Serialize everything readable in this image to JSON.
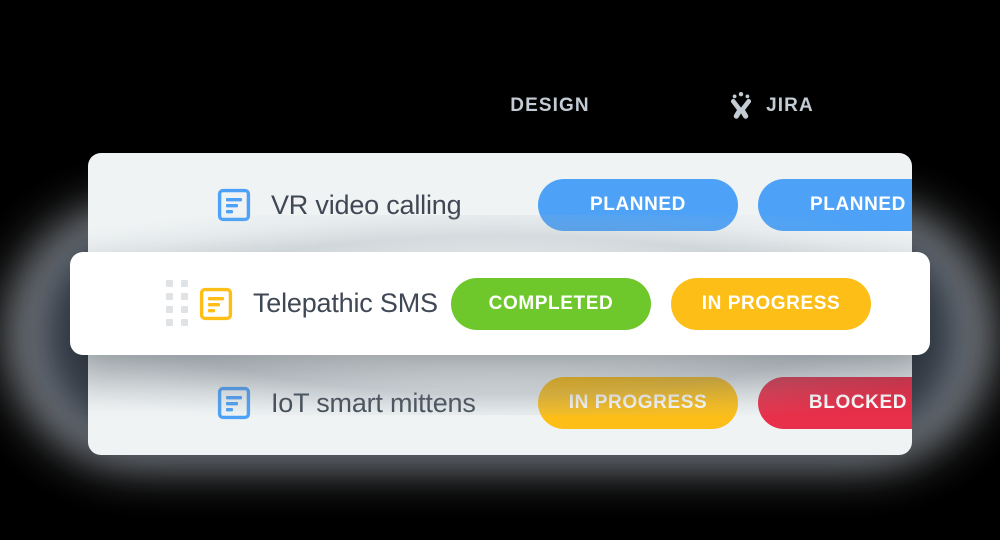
{
  "theme": {
    "background": "#000000",
    "back_card_bg": "#eff3f4",
    "float_card_bg": "#ffffff",
    "header_text_color": "#c3ccd4",
    "title_text_color": "#3f4854",
    "status_colors": {
      "planned": "#4da2f7",
      "completed": "#6fc82b",
      "in_progress": "#fdbf17",
      "blocked": "#e8304a"
    }
  },
  "columns": [
    {
      "id": "design",
      "label": "DESIGN",
      "icon": null
    },
    {
      "id": "jira",
      "label": "JIRA",
      "icon": "jira-person-icon"
    }
  ],
  "rows": [
    {
      "id": "vr-video-calling",
      "icon": "document-icon",
      "icon_color": "#4da2f7",
      "title": "VR video calling",
      "dragging": false,
      "statuses": [
        {
          "column": "design",
          "label": "PLANNED",
          "state": "planned"
        },
        {
          "column": "jira",
          "label": "PLANNED",
          "state": "planned"
        }
      ]
    },
    {
      "id": "telepathic-sms",
      "icon": "document-icon",
      "icon_color": "#fdbf17",
      "title": "Telepathic SMS",
      "dragging": true,
      "drag_handle": "drag-handle-icon",
      "statuses": [
        {
          "column": "design",
          "label": "COMPLETED",
          "state": "completed"
        },
        {
          "column": "jira",
          "label": "IN PROGRESS",
          "state": "in_progress"
        }
      ]
    },
    {
      "id": "iot-smart-mittens",
      "icon": "document-icon",
      "icon_color": "#4da2f7",
      "title": "IoT smart mittens",
      "dragging": false,
      "statuses": [
        {
          "column": "design",
          "label": "IN PROGRESS",
          "state": "in_progress"
        },
        {
          "column": "jira",
          "label": "BLOCKED",
          "state": "blocked"
        }
      ]
    }
  ]
}
